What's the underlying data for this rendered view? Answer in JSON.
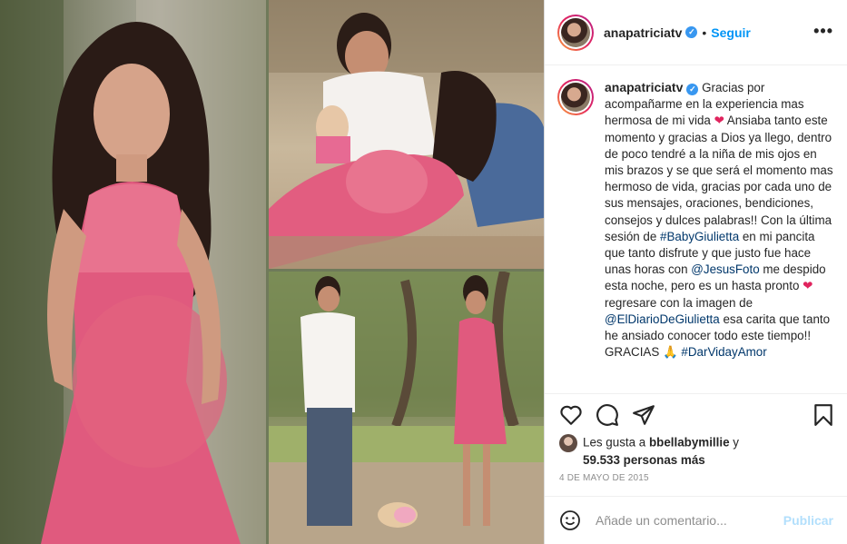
{
  "post": {
    "username": "anapatriciatv",
    "verified_mark": "✓",
    "separator": "•",
    "follow_label": "Seguir",
    "more_icon": "•••",
    "caption": {
      "username": "anapatriciatv",
      "segments": [
        {
          "type": "text",
          "value": " Gracias por acompañarme en la experiencia mas hermosa de mi vida "
        },
        {
          "type": "emoji",
          "value": "❤"
        },
        {
          "type": "text",
          "value": " Ansiaba tanto este momento y gracias a Dios ya llego, dentro de poco tendré a la niña de mis ojos en mis brazos y se que será el momento mas hermoso de vida, gracias por cada uno de sus mensajes, oraciones, bendiciones, consejos y dulces palabras!! Con la última sesión de "
        },
        {
          "type": "link",
          "value": "#BabyGiulietta"
        },
        {
          "type": "text",
          "value": " en mi pancita que tanto disfrute y que justo fue hace unas horas con "
        },
        {
          "type": "link",
          "value": "@JesusFoto"
        },
        {
          "type": "text",
          "value": " me despido esta noche, pero es un hasta pronto "
        },
        {
          "type": "emoji",
          "value": "❤"
        },
        {
          "type": "text",
          "value": " regresare con la imagen de "
        },
        {
          "type": "link",
          "value": "@ElDiarioDeGiulietta"
        },
        {
          "type": "text",
          "value": " esa carita que tanto he ansiado conocer todo este tiempo!! GRACIAS "
        },
        {
          "type": "emoji",
          "value": "🙏"
        },
        {
          "type": "text",
          "value": " "
        },
        {
          "type": "link",
          "value": "#DarVidayAmor"
        }
      ]
    },
    "actions": {
      "like_icon": "heart-icon",
      "comment_icon": "comment-icon",
      "share_icon": "share-icon",
      "save_icon": "bookmark-icon"
    },
    "likes": {
      "prefix": "Les gusta a ",
      "user": "bbellabymillie",
      "conjunction": " y",
      "count_text": "59.533 personas más"
    },
    "date": "4 DE MAYO DE 2015",
    "comment": {
      "placeholder": "Añade un comentario...",
      "publish_label": "Publicar"
    },
    "colors": {
      "link": "#00376b",
      "follow": "#0095f6",
      "publish_disabled": "#b2dffc",
      "dress_pink": "#e05a7e"
    }
  }
}
